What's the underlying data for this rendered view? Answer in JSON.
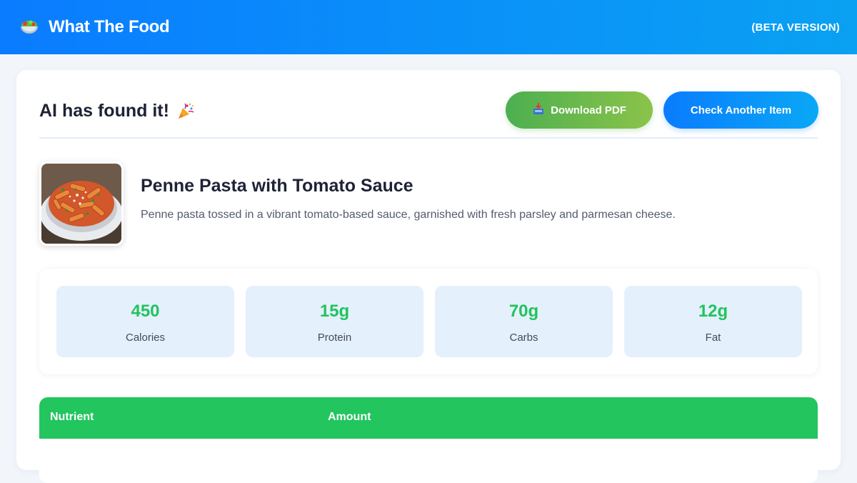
{
  "app": {
    "title": "What The Food",
    "beta_label": "(BETA VERSION)",
    "brand_icon": "salad-bowl-icon"
  },
  "result": {
    "heading": "AI has found it!",
    "heading_icon": "party-popper-icon",
    "download_button": "Download PDF",
    "download_icon": "download-tray-icon",
    "check_button": "Check Another Item"
  },
  "food": {
    "name": "Penne Pasta with Tomato Sauce",
    "description": "Penne pasta tossed in a vibrant tomato-based sauce, garnished with fresh parsley and parmesan cheese."
  },
  "stats": [
    {
      "value": "450",
      "label": "Calories"
    },
    {
      "value": "15g",
      "label": "Protein"
    },
    {
      "value": "70g",
      "label": "Carbs"
    },
    {
      "value": "12g",
      "label": "Fat"
    }
  ],
  "table": {
    "headers": [
      "Nutrient",
      "Amount"
    ]
  },
  "colors": {
    "header_gradient_start": "#0a7cff",
    "header_gradient_end": "#0aa1f2",
    "stat_value": "#22c35e",
    "table_header": "#22c55e",
    "pdf_gradient_start": "#4caf50",
    "pdf_gradient_end": "#8bc34a"
  }
}
